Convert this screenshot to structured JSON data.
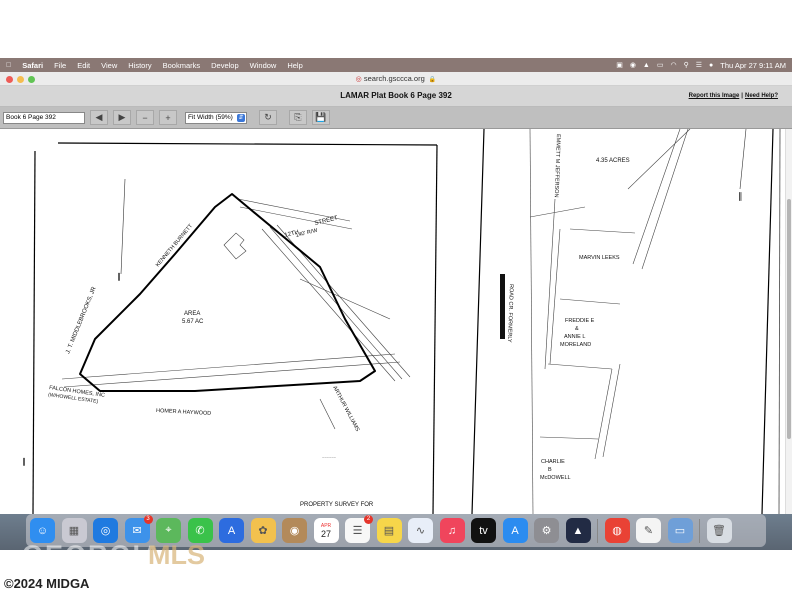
{
  "menubar": {
    "apple_icon": "apple-icon",
    "app_name": "Safari",
    "items": [
      "File",
      "Edit",
      "View",
      "History",
      "Bookmarks",
      "Develop",
      "Window",
      "Help"
    ],
    "clock": "Thu Apr 27  9:11 AM"
  },
  "browser": {
    "url": "search.gsccca.org",
    "traffic_colors": [
      "#ee5b56",
      "#f5bd4f",
      "#61c454"
    ]
  },
  "viewer": {
    "title": "LAMAR Plat Book 6 Page 392",
    "report_link": "Report this Image",
    "help_link": "Need Help?",
    "page_field": "Book 6 Page 392",
    "zoom": "Fit Width (59%)"
  },
  "plat": {
    "area_label": "AREA",
    "area_value": "5.67 AC",
    "north_street": "12TH",
    "street": "STREET",
    "row": "140' R/W",
    "owners_left": {
      "kenneth": "KENNETH BURNETT",
      "moorehead": "J. T. MIDDLEBROOKS, JR",
      "falcon": "FALCON HOMES, INC",
      "falcon_sub": "(W/HOWELL ESTATE)",
      "homer": "HOMER A HAYWOOD",
      "arthur": "ARTHUR WILLIAMS"
    },
    "survey_caption": "PROPERTY SURVEY FOR",
    "right_labels": {
      "acres": "4.35 ACRES",
      "emmett": "EMMETT M JEFFERSON",
      "marvin": "MARVIN LEEKS",
      "freddie1": "FREDDIE E",
      "freddie2": "&",
      "freddie3": "ANNIE L",
      "freddie4": "MORELAND",
      "charlie1": "CHARLIE",
      "charlie2": "B",
      "charlie3": "McDOWELL",
      "road": "ROAD CR. FORMERLY"
    }
  },
  "dock": {
    "icons": [
      {
        "name": "finder-icon",
        "color": "#2f8ef0",
        "glyph": "☺"
      },
      {
        "name": "launchpad-icon",
        "color": "#c9c9d2",
        "glyph": "▦"
      },
      {
        "name": "safari-icon",
        "color": "#1f7ae0",
        "glyph": "◎"
      },
      {
        "name": "mail-icon",
        "color": "#3d92ea",
        "glyph": "✉",
        "badge": "3"
      },
      {
        "name": "maps-icon",
        "color": "#5cb85c",
        "glyph": "⌖"
      },
      {
        "name": "messages-icon",
        "color": "#3ac24a",
        "glyph": "✆"
      },
      {
        "name": "appstore-connect-icon",
        "color": "#2d6cdf",
        "glyph": "A"
      },
      {
        "name": "photos-icon",
        "color": "#f2c14e",
        "glyph": "✿"
      },
      {
        "name": "contacts-icon",
        "color": "#b38a5a",
        "glyph": "◉"
      },
      {
        "name": "calendar-icon",
        "color": "#ffffff",
        "glyph": "27"
      },
      {
        "name": "reminders-icon",
        "color": "#f7f7f7",
        "glyph": "☰",
        "badge": "2"
      },
      {
        "name": "notes-icon",
        "color": "#f6d64a",
        "glyph": "▤"
      },
      {
        "name": "freeform-icon",
        "color": "#e8eef8",
        "glyph": "∿"
      },
      {
        "name": "music-icon",
        "color": "#f0455c",
        "glyph": "♫"
      },
      {
        "name": "tv-icon",
        "color": "#111111",
        "glyph": "tv"
      },
      {
        "name": "appstore-icon",
        "color": "#2b8cf0",
        "glyph": "A"
      },
      {
        "name": "settings-icon",
        "color": "#8e8e93",
        "glyph": "⚙"
      },
      {
        "name": "xcode-instruments-icon",
        "color": "#222b44",
        "glyph": "▲"
      },
      {
        "name": "chrome-icon",
        "color": "#e94235",
        "glyph": "◍"
      },
      {
        "name": "textedit-icon",
        "color": "#f4f4f4",
        "glyph": "✎"
      },
      {
        "name": "preview-icon",
        "color": "#6f9fd8",
        "glyph": "▭"
      }
    ],
    "trash": {
      "name": "trash-icon",
      "color": "#d8dde3",
      "glyph": "🗑"
    },
    "calendar_month": "APR"
  },
  "watermark": {
    "georgia": "GEORGIA",
    "mls": "MLS",
    "copyright": "©2024 MIDGA"
  }
}
